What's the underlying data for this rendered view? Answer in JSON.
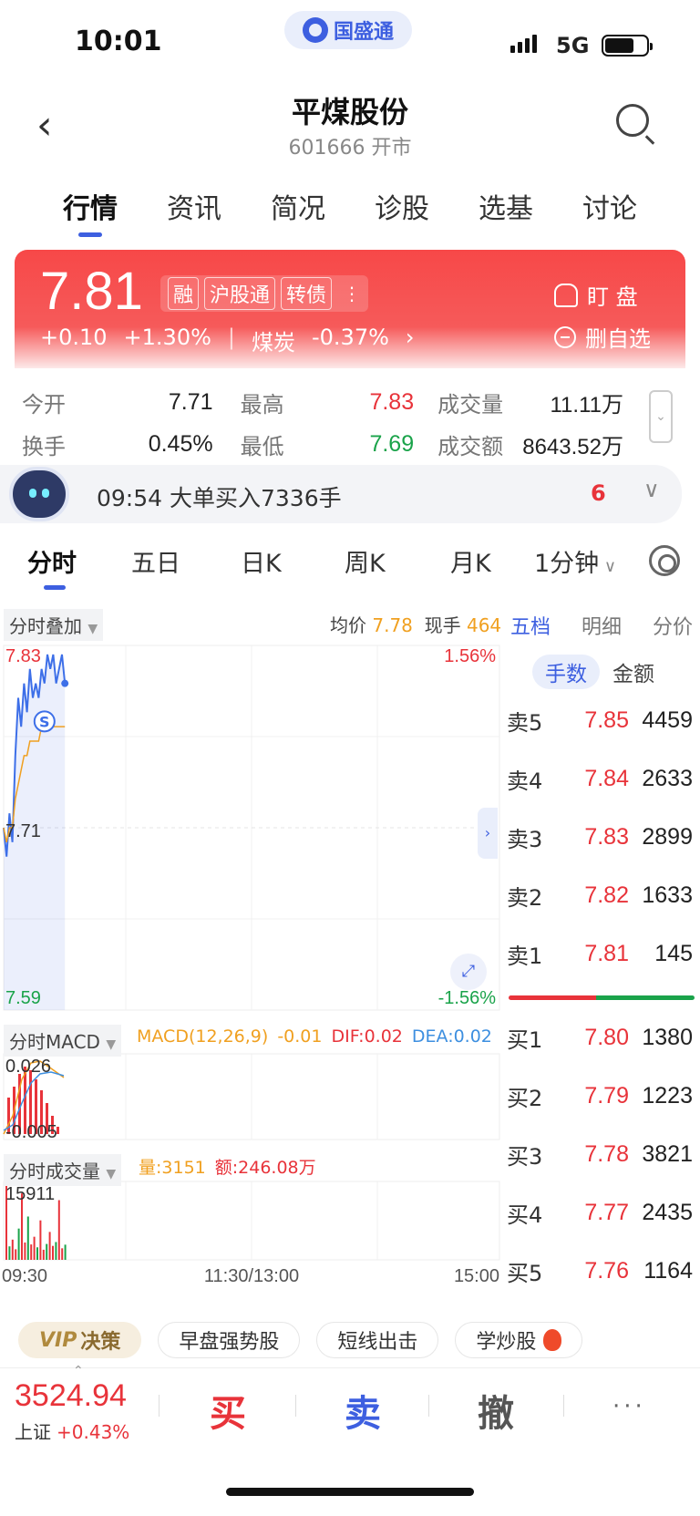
{
  "status": {
    "time": "10:01",
    "network": "5G",
    "app_badge": "国盛通"
  },
  "header": {
    "title": "平煤股份",
    "subtitle": "601666 开市"
  },
  "tabs": [
    {
      "label": "行情",
      "active": true
    },
    {
      "label": "资讯",
      "active": false
    },
    {
      "label": "简况",
      "active": false
    },
    {
      "label": "诊股",
      "active": false
    },
    {
      "label": "选基",
      "active": false
    },
    {
      "label": "讨论",
      "active": false
    }
  ],
  "quote": {
    "price": "7.81",
    "change": "+0.10",
    "change_pct": "+1.30%",
    "sector_name": "煤炭",
    "sector_pct": "-0.37%",
    "badges": [
      "融",
      "沪股通",
      "转债"
    ],
    "watch_label": "盯  盘",
    "remove_fav_label": "删自选"
  },
  "stats": {
    "open_label": "今开",
    "open": "7.71",
    "high_label": "最高",
    "high": "7.83",
    "volume_label": "成交量",
    "volume": "11.11万",
    "turnover_label": "换手",
    "turnover": "0.45%",
    "low_label": "最低",
    "low": "7.69",
    "amount_label": "成交额",
    "amount": "8643.52万"
  },
  "news": {
    "text": "09:54 大单买入7336手",
    "count": "6"
  },
  "chart_tabs": [
    "分时",
    "五日",
    "日K",
    "周K",
    "月K",
    "1分钟"
  ],
  "chart_header": {
    "overlay_label": "分时叠加",
    "avg_label": "均价",
    "avg_value": "7.78",
    "hand_label": "现手",
    "hand_value": "464"
  },
  "side_tabs": [
    "五档",
    "明细",
    "分价"
  ],
  "side_seg": [
    "手数",
    "金额"
  ],
  "order_book": {
    "asks": [
      {
        "label": "卖5",
        "price": "7.85",
        "vol": "4459"
      },
      {
        "label": "卖4",
        "price": "7.84",
        "vol": "2633"
      },
      {
        "label": "卖3",
        "price": "7.83",
        "vol": "2899"
      },
      {
        "label": "卖2",
        "price": "7.82",
        "vol": "1633"
      },
      {
        "label": "卖1",
        "price": "7.81",
        "vol": "145"
      }
    ],
    "bids": [
      {
        "label": "买1",
        "price": "7.80",
        "vol": "1380"
      },
      {
        "label": "买2",
        "price": "7.79",
        "vol": "1223"
      },
      {
        "label": "买3",
        "price": "7.78",
        "vol": "3821"
      },
      {
        "label": "买4",
        "price": "7.77",
        "vol": "2435"
      },
      {
        "label": "买5",
        "price": "7.76",
        "vol": "1164"
      }
    ]
  },
  "macd": {
    "label": "分时MACD",
    "params": "MACD(12,26,9)",
    "macd": "-0.01",
    "dif": "DIF:0.02",
    "dea": "DEA:0.02",
    "axis_max": "0.026",
    "axis_min": "-0.005"
  },
  "volume_panel": {
    "label": "分时成交量",
    "vol": "量:3151",
    "amt": "额:246.08万",
    "axis_max": "15911"
  },
  "chart_data": [
    {
      "type": "line",
      "title": "",
      "y_left_ticks": [
        "7.83",
        "7.71",
        "7.59"
      ],
      "y_right_ticks": [
        "1.56%",
        "-1.56%"
      ],
      "ylim": [
        7.59,
        7.83
      ],
      "x_ticks": [
        "09:30",
        "11:30/13:00",
        "15:00"
      ],
      "series": [
        {
          "values": [
            7.71,
            7.69,
            7.72,
            7.7,
            7.76,
            7.8,
            7.78,
            7.81,
            7.79,
            7.82,
            7.8,
            7.81,
            7.8,
            7.82,
            7.81,
            7.83,
            7.82,
            7.83,
            7.81,
            7.82,
            7.83,
            7.81
          ]
        },
        {
          "values": [
            7.71,
            7.7,
            7.71,
            7.71,
            7.73,
            7.74,
            7.75,
            7.76,
            7.76,
            7.77,
            7.77,
            7.77,
            7.77,
            7.78,
            7.78,
            7.78,
            7.78,
            7.78,
            7.78,
            7.78,
            7.78,
            7.78
          ]
        }
      ]
    },
    {
      "type": "bar",
      "title": "",
      "ylim": [
        0,
        15911
      ],
      "values": [
        15911,
        2800,
        4200,
        2200,
        6500,
        13800,
        3600,
        9000,
        3200,
        4800,
        2600,
        8200,
        2100,
        3300,
        5800,
        2900,
        3700,
        12400,
        2400,
        3151
      ]
    }
  ],
  "chips": [
    "决策",
    "早盘强势股",
    "短线出击",
    "学炒股"
  ],
  "chip_vip": "VIP",
  "index_bar": {
    "value": "3524.94",
    "name": "上证",
    "pct": "+0.43%"
  },
  "trade": {
    "buy": "买",
    "sell": "卖",
    "cancel": "撤",
    "more": "···"
  },
  "colors": {
    "up": "#e8333a",
    "down": "#1aa34a",
    "accent": "#3d5fe0",
    "avg_line": "#f0a020"
  }
}
